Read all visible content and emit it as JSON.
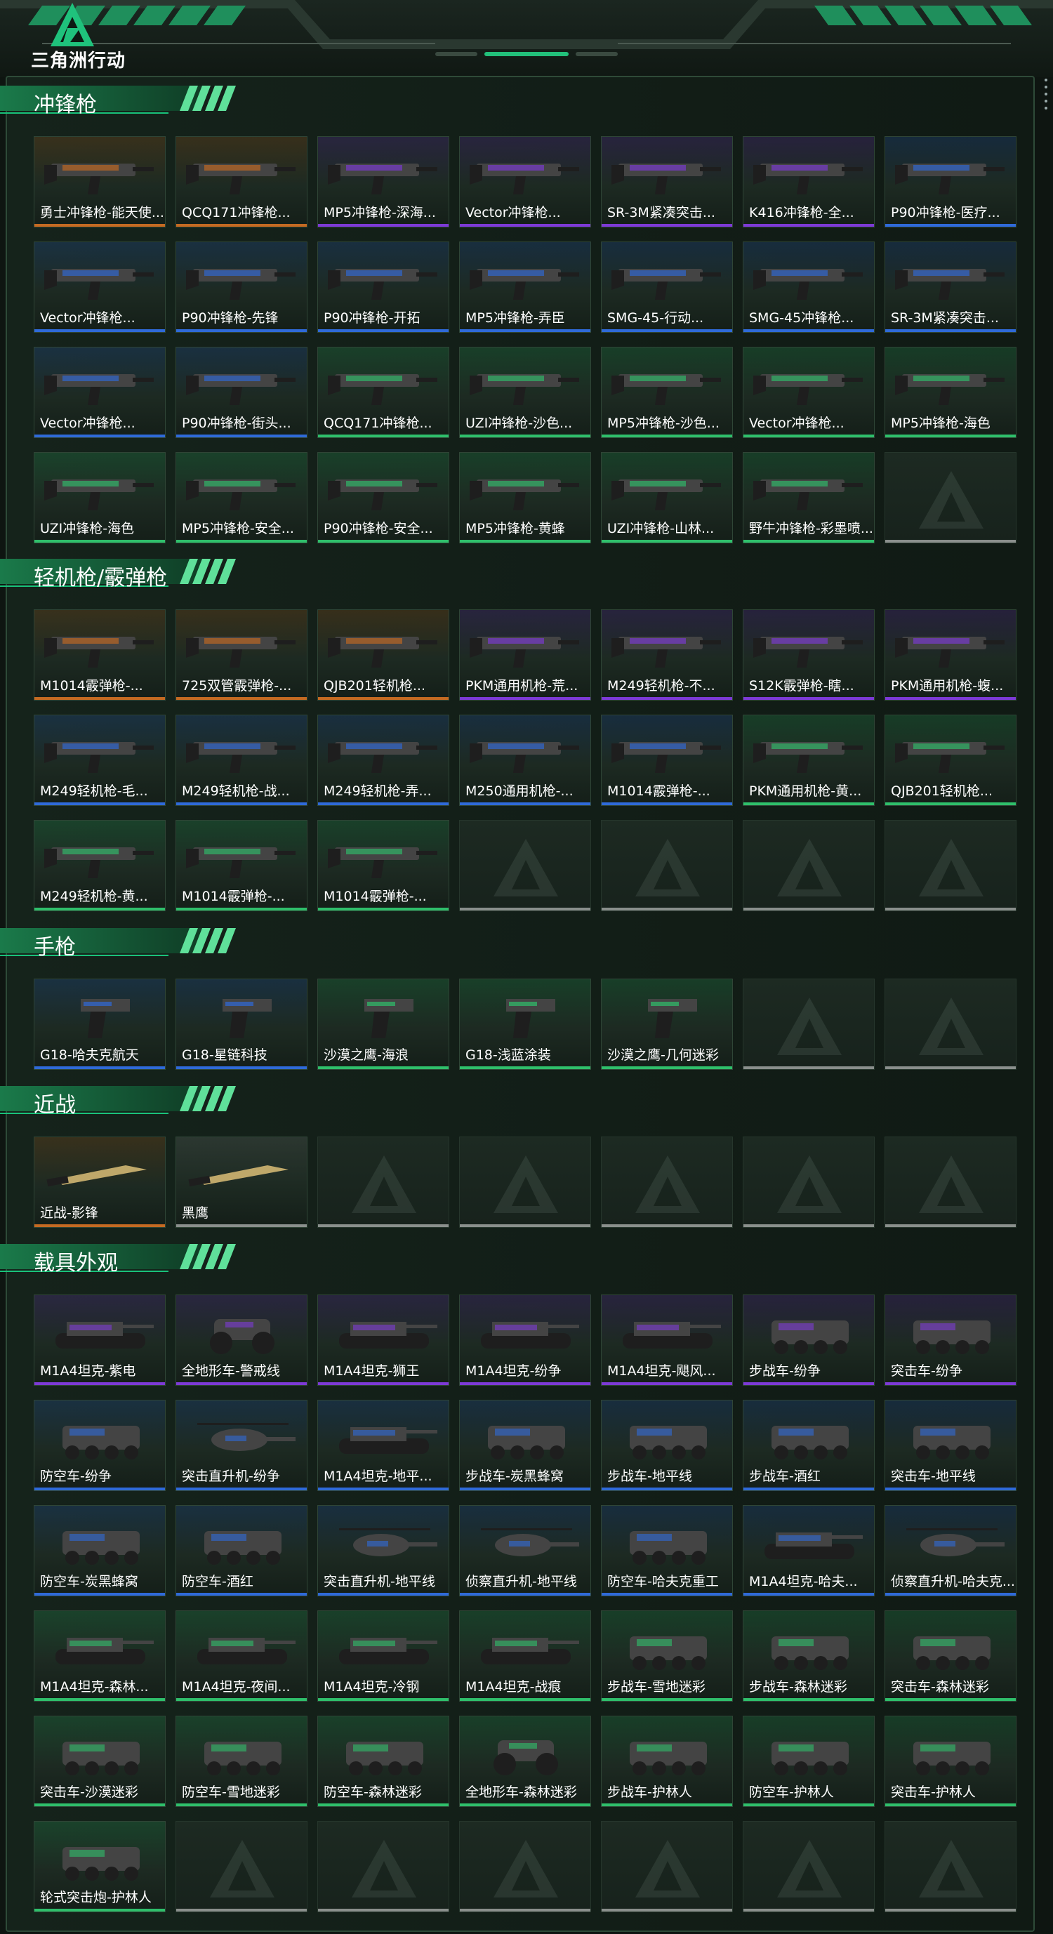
{
  "app": {
    "logo_text": "三角洲行动"
  },
  "colors": {
    "gold": "#c46a22",
    "purple": "#7d3ad6",
    "blue": "#2f6ad9",
    "green": "#2fbf6b",
    "gray": "#8a8f8c",
    "accent": "#19c27a"
  },
  "sections": [
    {
      "title": "冲锋枪",
      "items": [
        {
          "label": "勇士冲锋枪-能天使...",
          "rarity": "gold",
          "icon": "smg-icon"
        },
        {
          "label": "QCQ171冲锋枪...",
          "rarity": "gold",
          "icon": "smg-icon"
        },
        {
          "label": "MP5冲锋枪-深海...",
          "rarity": "purple",
          "icon": "smg-icon"
        },
        {
          "label": "Vector冲锋枪...",
          "rarity": "purple",
          "icon": "smg-icon"
        },
        {
          "label": "SR-3M紧凑突击...",
          "rarity": "purple",
          "icon": "smg-icon"
        },
        {
          "label": "K416冲锋枪-全...",
          "rarity": "purple",
          "icon": "smg-icon"
        },
        {
          "label": "P90冲锋枪-医疗...",
          "rarity": "blue",
          "icon": "smg-icon"
        },
        {
          "label": "Vector冲锋枪...",
          "rarity": "blue",
          "icon": "smg-icon"
        },
        {
          "label": "P90冲锋枪-先锋",
          "rarity": "blue",
          "icon": "smg-icon"
        },
        {
          "label": "P90冲锋枪-开拓",
          "rarity": "blue",
          "icon": "smg-icon"
        },
        {
          "label": "MP5冲锋枪-弄臣",
          "rarity": "blue",
          "icon": "smg-icon"
        },
        {
          "label": "SMG-45-行动...",
          "rarity": "blue",
          "icon": "smg-icon"
        },
        {
          "label": "SMG-45冲锋枪...",
          "rarity": "blue",
          "icon": "smg-icon"
        },
        {
          "label": "SR-3M紧凑突击...",
          "rarity": "blue",
          "icon": "smg-icon"
        },
        {
          "label": "Vector冲锋枪...",
          "rarity": "blue",
          "icon": "smg-icon"
        },
        {
          "label": "P90冲锋枪-街头...",
          "rarity": "blue",
          "icon": "smg-icon"
        },
        {
          "label": "QCQ171冲锋枪...",
          "rarity": "green",
          "icon": "smg-icon"
        },
        {
          "label": "UZI冲锋枪-沙色...",
          "rarity": "green",
          "icon": "smg-icon"
        },
        {
          "label": "MP5冲锋枪-沙色...",
          "rarity": "green",
          "icon": "smg-icon"
        },
        {
          "label": "Vector冲锋枪...",
          "rarity": "green",
          "icon": "smg-icon"
        },
        {
          "label": "MP5冲锋枪-海色",
          "rarity": "green",
          "icon": "smg-icon"
        },
        {
          "label": "UZI冲锋枪-海色",
          "rarity": "green",
          "icon": "smg-icon"
        },
        {
          "label": "MP5冲锋枪-安全...",
          "rarity": "green",
          "icon": "smg-icon"
        },
        {
          "label": "P90冲锋枪-安全...",
          "rarity": "green",
          "icon": "smg-icon"
        },
        {
          "label": "MP5冲锋枪-黄蜂",
          "rarity": "green",
          "icon": "smg-icon"
        },
        {
          "label": "UZI冲锋枪-山林...",
          "rarity": "green",
          "icon": "smg-icon"
        },
        {
          "label": "野牛冲锋枪-彩墨喷...",
          "rarity": "green",
          "icon": "smg-icon"
        }
      ]
    },
    {
      "title": "轻机枪/霰弹枪",
      "items": [
        {
          "label": "M1014霰弹枪-...",
          "rarity": "gold",
          "icon": "shotgun-icon"
        },
        {
          "label": "725双管霰弹枪-...",
          "rarity": "gold",
          "icon": "shotgun-icon"
        },
        {
          "label": "QJB201轻机枪...",
          "rarity": "gold",
          "icon": "lmg-icon"
        },
        {
          "label": "PKM通用机枪-荒...",
          "rarity": "purple",
          "icon": "lmg-icon"
        },
        {
          "label": "M249轻机枪-不...",
          "rarity": "purple",
          "icon": "lmg-icon"
        },
        {
          "label": "S12K霰弹枪-瞎...",
          "rarity": "purple",
          "icon": "shotgun-icon"
        },
        {
          "label": "PKM通用机枪-蝮...",
          "rarity": "purple",
          "icon": "lmg-icon"
        },
        {
          "label": "M249轻机枪-毛...",
          "rarity": "blue",
          "icon": "lmg-icon"
        },
        {
          "label": "M249轻机枪-战...",
          "rarity": "blue",
          "icon": "lmg-icon"
        },
        {
          "label": "M249轻机枪-弄...",
          "rarity": "blue",
          "icon": "lmg-icon"
        },
        {
          "label": "M250通用机枪-...",
          "rarity": "blue",
          "icon": "lmg-icon"
        },
        {
          "label": "M1014霰弹枪-...",
          "rarity": "blue",
          "icon": "shotgun-icon"
        },
        {
          "label": "PKM通用机枪-黄...",
          "rarity": "green",
          "icon": "lmg-icon"
        },
        {
          "label": "QJB201轻机枪...",
          "rarity": "green",
          "icon": "lmg-icon"
        },
        {
          "label": "M249轻机枪-黄...",
          "rarity": "green",
          "icon": "lmg-icon"
        },
        {
          "label": "M1014霰弹枪-...",
          "rarity": "green",
          "icon": "shotgun-icon"
        },
        {
          "label": "M1014霰弹枪-...",
          "rarity": "green",
          "icon": "shotgun-icon"
        }
      ]
    },
    {
      "title": "手枪",
      "items": [
        {
          "label": "G18-哈夫克航天",
          "rarity": "blue",
          "icon": "pistol-icon"
        },
        {
          "label": "G18-星链科技",
          "rarity": "blue",
          "icon": "pistol-icon"
        },
        {
          "label": "沙漠之鹰-海浪",
          "rarity": "green",
          "icon": "pistol-icon"
        },
        {
          "label": "G18-浅蓝涂装",
          "rarity": "green",
          "icon": "pistol-icon"
        },
        {
          "label": "沙漠之鹰-几何迷彩",
          "rarity": "green",
          "icon": "pistol-icon"
        }
      ]
    },
    {
      "title": "近战",
      "items": [
        {
          "label": "近战-影锋",
          "rarity": "gold",
          "icon": "blade-icon"
        },
        {
          "label": "黑鹰",
          "rarity": "gray",
          "icon": "knife-icon"
        }
      ]
    },
    {
      "title": "载具外观",
      "items": [
        {
          "label": "M1A4坦克-紫电",
          "rarity": "purple",
          "icon": "tank-icon"
        },
        {
          "label": "全地形车-警戒线",
          "rarity": "purple",
          "icon": "atv-icon"
        },
        {
          "label": "M1A4坦克-狮王",
          "rarity": "purple",
          "icon": "tank-icon"
        },
        {
          "label": "M1A4坦克-纷争",
          "rarity": "purple",
          "icon": "tank-icon"
        },
        {
          "label": "M1A4坦克-飓风...",
          "rarity": "purple",
          "icon": "tank-icon"
        },
        {
          "label": "步战车-纷争",
          "rarity": "purple",
          "icon": "ifv-icon"
        },
        {
          "label": "突击车-纷争",
          "rarity": "purple",
          "icon": "assault-vehicle-icon"
        },
        {
          "label": "防空车-纷争",
          "rarity": "blue",
          "icon": "ifv-icon"
        },
        {
          "label": "突击直升机-纷争",
          "rarity": "blue",
          "icon": "helicopter-icon"
        },
        {
          "label": "M1A4坦克-地平...",
          "rarity": "blue",
          "icon": "tank-icon"
        },
        {
          "label": "步战车-炭黑蜂窝",
          "rarity": "blue",
          "icon": "ifv-icon"
        },
        {
          "label": "步战车-地平线",
          "rarity": "blue",
          "icon": "ifv-icon"
        },
        {
          "label": "步战车-酒红",
          "rarity": "blue",
          "icon": "ifv-icon"
        },
        {
          "label": "突击车-地平线",
          "rarity": "blue",
          "icon": "assault-vehicle-icon"
        },
        {
          "label": "防空车-炭黑蜂窝",
          "rarity": "blue",
          "icon": "ifv-icon"
        },
        {
          "label": "防空车-酒红",
          "rarity": "blue",
          "icon": "ifv-icon"
        },
        {
          "label": "突击直升机-地平线",
          "rarity": "blue",
          "icon": "helicopter-icon"
        },
        {
          "label": "侦察直升机-地平线",
          "rarity": "blue",
          "icon": "helicopter-icon"
        },
        {
          "label": "防空车-哈夫克重工",
          "rarity": "blue",
          "icon": "ifv-icon"
        },
        {
          "label": "M1A4坦克-哈夫...",
          "rarity": "blue",
          "icon": "tank-icon"
        },
        {
          "label": "侦察直升机-哈夫克...",
          "rarity": "blue",
          "icon": "helicopter-icon"
        },
        {
          "label": "M1A4坦克-森林...",
          "rarity": "green",
          "icon": "tank-icon"
        },
        {
          "label": "M1A4坦克-夜间...",
          "rarity": "green",
          "icon": "tank-icon"
        },
        {
          "label": "M1A4坦克-冷钢",
          "rarity": "green",
          "icon": "tank-icon"
        },
        {
          "label": "M1A4坦克-战痕",
          "rarity": "green",
          "icon": "tank-icon"
        },
        {
          "label": "步战车-雪地迷彩",
          "rarity": "green",
          "icon": "ifv-icon"
        },
        {
          "label": "步战车-森林迷彩",
          "rarity": "green",
          "icon": "ifv-icon"
        },
        {
          "label": "突击车-森林迷彩",
          "rarity": "green",
          "icon": "assault-vehicle-icon"
        },
        {
          "label": "突击车-沙漠迷彩",
          "rarity": "green",
          "icon": "assault-vehicle-icon"
        },
        {
          "label": "防空车-雪地迷彩",
          "rarity": "green",
          "icon": "ifv-icon"
        },
        {
          "label": "防空车-森林迷彩",
          "rarity": "green",
          "icon": "ifv-icon"
        },
        {
          "label": "全地形车-森林迷彩",
          "rarity": "green",
          "icon": "atv-icon"
        },
        {
          "label": "步战车-护林人",
          "rarity": "green",
          "icon": "ifv-icon"
        },
        {
          "label": "防空车-护林人",
          "rarity": "green",
          "icon": "ifv-icon"
        },
        {
          "label": "突击车-护林人",
          "rarity": "green",
          "icon": "assault-vehicle-icon"
        },
        {
          "label": "轮式突击炮-护林人",
          "rarity": "green",
          "icon": "ifv-icon"
        }
      ]
    }
  ]
}
